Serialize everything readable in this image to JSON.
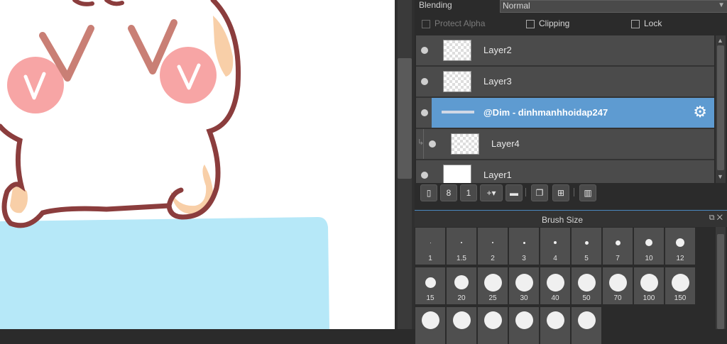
{
  "panel": {
    "blending_label": "Blending",
    "blending_value": "Normal",
    "checkboxes": [
      {
        "label": "Protect Alpha",
        "checked": false,
        "enabled": false
      },
      {
        "label": "Clipping",
        "checked": false,
        "enabled": true
      },
      {
        "label": "Lock",
        "checked": false,
        "enabled": true
      }
    ],
    "layers": [
      {
        "name": "Layer2",
        "selected": false,
        "clipped": false
      },
      {
        "name": "Layer3",
        "selected": false,
        "clipped": false
      },
      {
        "name": "@Dim - dinhmanhhoidap247",
        "selected": true,
        "clipped": false
      },
      {
        "name": "Layer4",
        "selected": false,
        "clipped": true
      },
      {
        "name": "Layer1",
        "selected": false,
        "clipped": false
      }
    ],
    "layer_toolbar_icons": [
      "new-layer-icon",
      "new-8bit-layer-icon",
      "new-1bit-layer-icon",
      "add-layer-dropdown-icon",
      "folder-icon",
      "duplicate-layer-icon",
      "merge-down-icon",
      "delete-layer-icon"
    ]
  },
  "brush_size": {
    "title": "Brush Size",
    "sizes": [
      "1",
      "1.5",
      "2",
      "3",
      "4",
      "5",
      "7",
      "10",
      "12",
      "15",
      "20",
      "25",
      "30",
      "40",
      "50",
      "70",
      "100",
      "150",
      "",
      "",
      "",
      "",
      "",
      ""
    ]
  },
  "colors": {
    "selection": "#5e9bd1",
    "panel_bg": "#2b2b2b",
    "canvas_blue": "#b6e8f8",
    "outline": "#8b3d3d",
    "cheek": "#f7a5a5"
  }
}
